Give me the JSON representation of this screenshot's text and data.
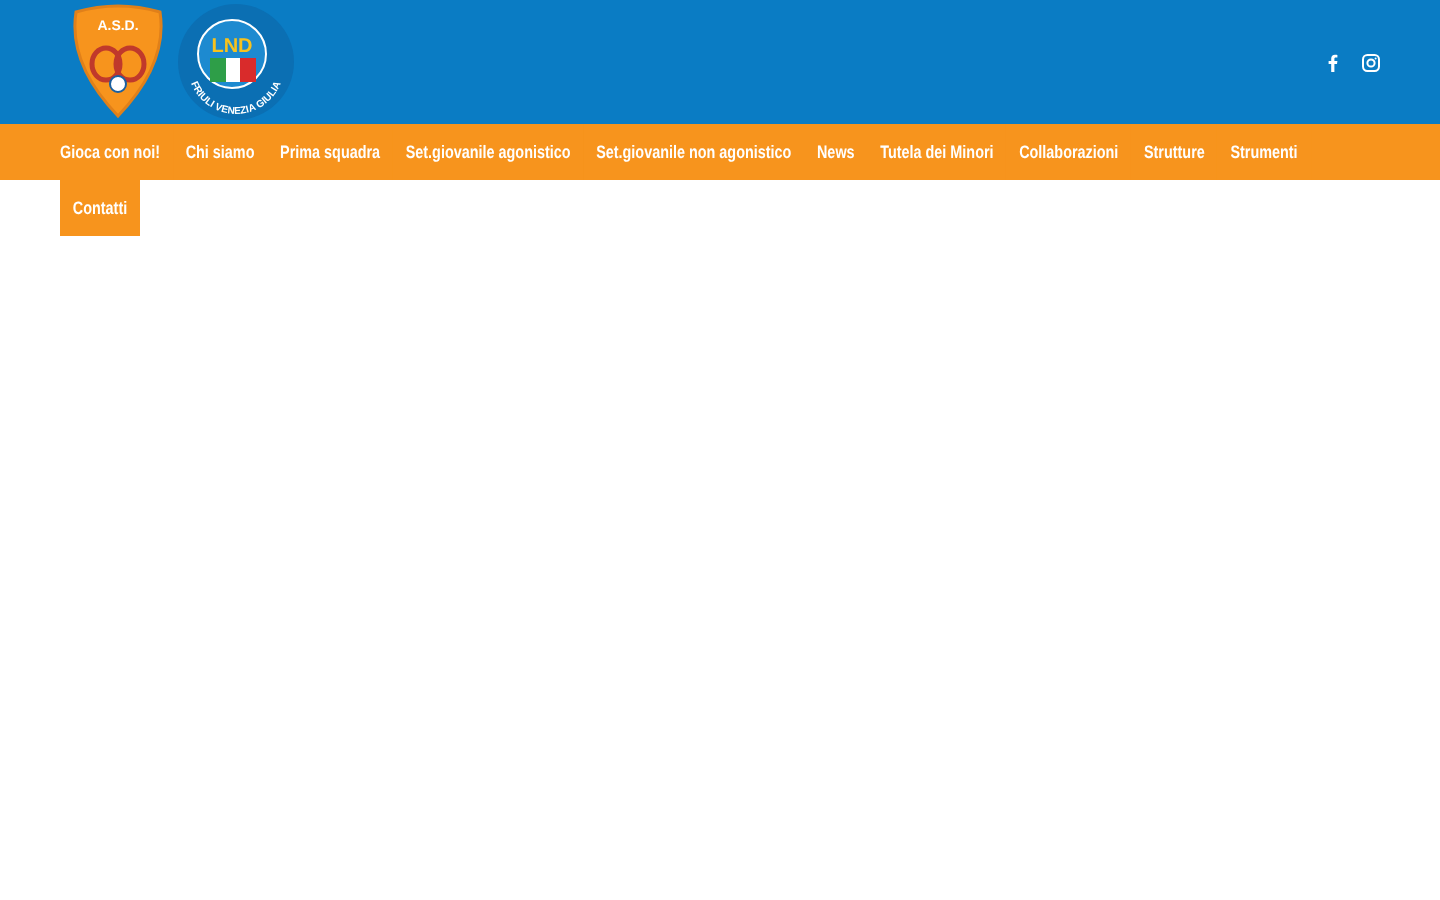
{
  "logos": {
    "club_initials": "A.S.D.",
    "league_initials": "LND",
    "league_region": "FRIULI VENEZIA GIULIA"
  },
  "social_links": [
    {
      "kind": "facebook"
    },
    {
      "kind": "instagram"
    }
  ],
  "nav": [
    {
      "label": "Gioca con noi!",
      "selected": false
    },
    {
      "label": "Chi siamo",
      "selected": false
    },
    {
      "label": "Prima squadra",
      "selected": false
    },
    {
      "label": "Set.giovanile agonistico",
      "selected": false
    },
    {
      "label": "Set.giovanile non agonistico",
      "selected": false
    },
    {
      "label": "News",
      "selected": false
    },
    {
      "label": "Tutela dei Minori",
      "selected": false
    },
    {
      "label": "Collaborazioni",
      "selected": false
    },
    {
      "label": "Strutture",
      "selected": false
    },
    {
      "label": "Strumenti",
      "selected": false
    },
    {
      "label": "Contatti",
      "selected": false
    }
  ]
}
